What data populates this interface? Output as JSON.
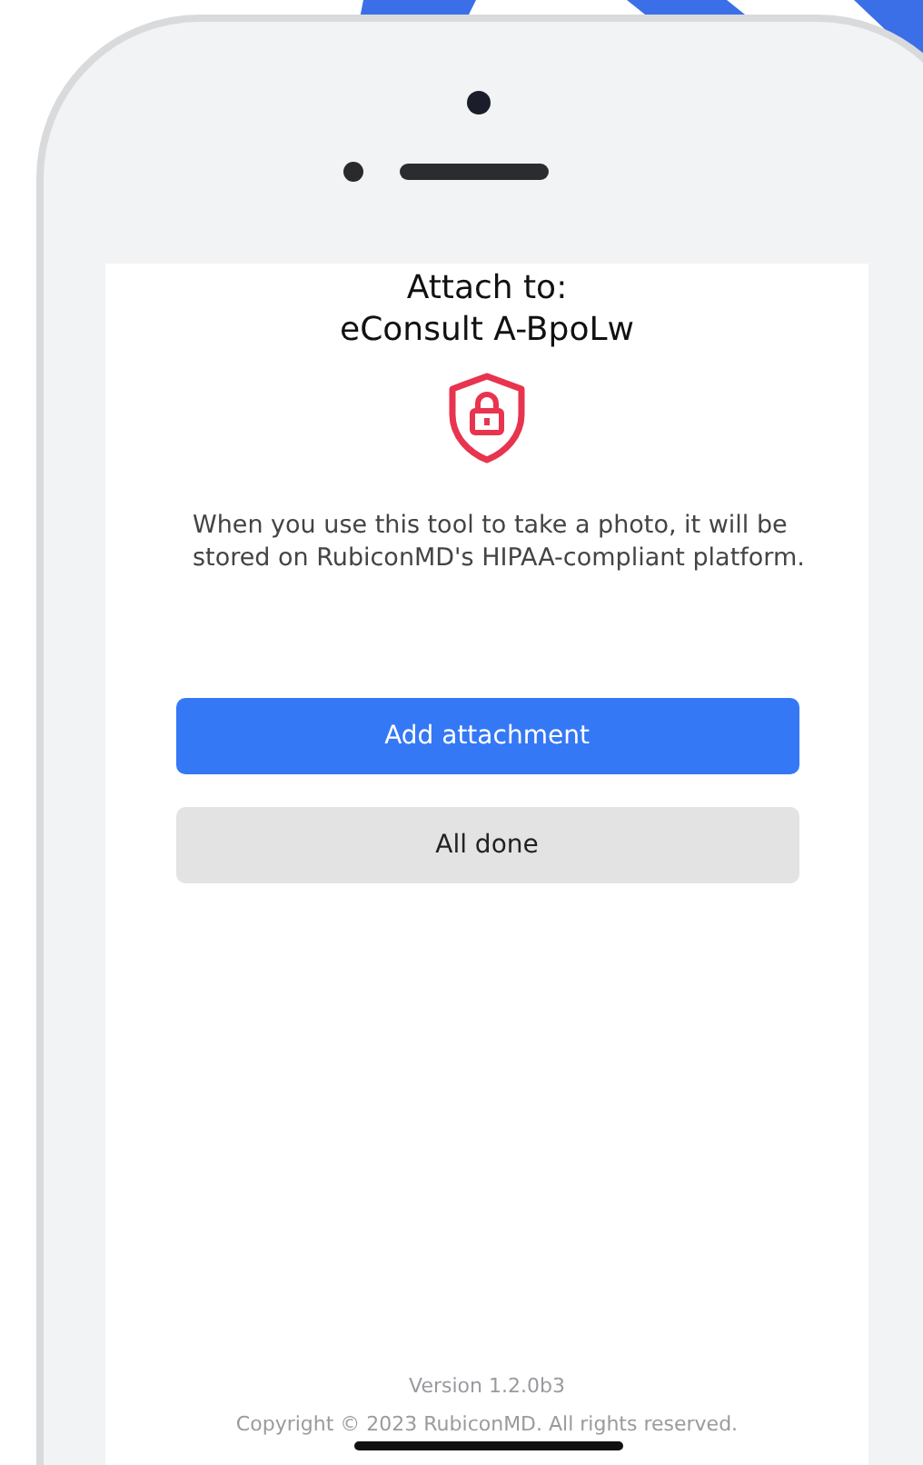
{
  "screen": {
    "title_lines": [
      "Attach to:",
      "eConsult A-BpoLw"
    ],
    "message": "When you use this tool to take a photo, it will be stored on RubiconMD's HIPAA-compliant platform.",
    "buttons": [
      {
        "label": "Add attachment",
        "kind": "primary"
      },
      {
        "label": "All done",
        "kind": "secondary"
      }
    ],
    "version": "Version 1.2.0b3",
    "copyright": "Copyright © 2023 RubiconMD. All rights reserved."
  }
}
